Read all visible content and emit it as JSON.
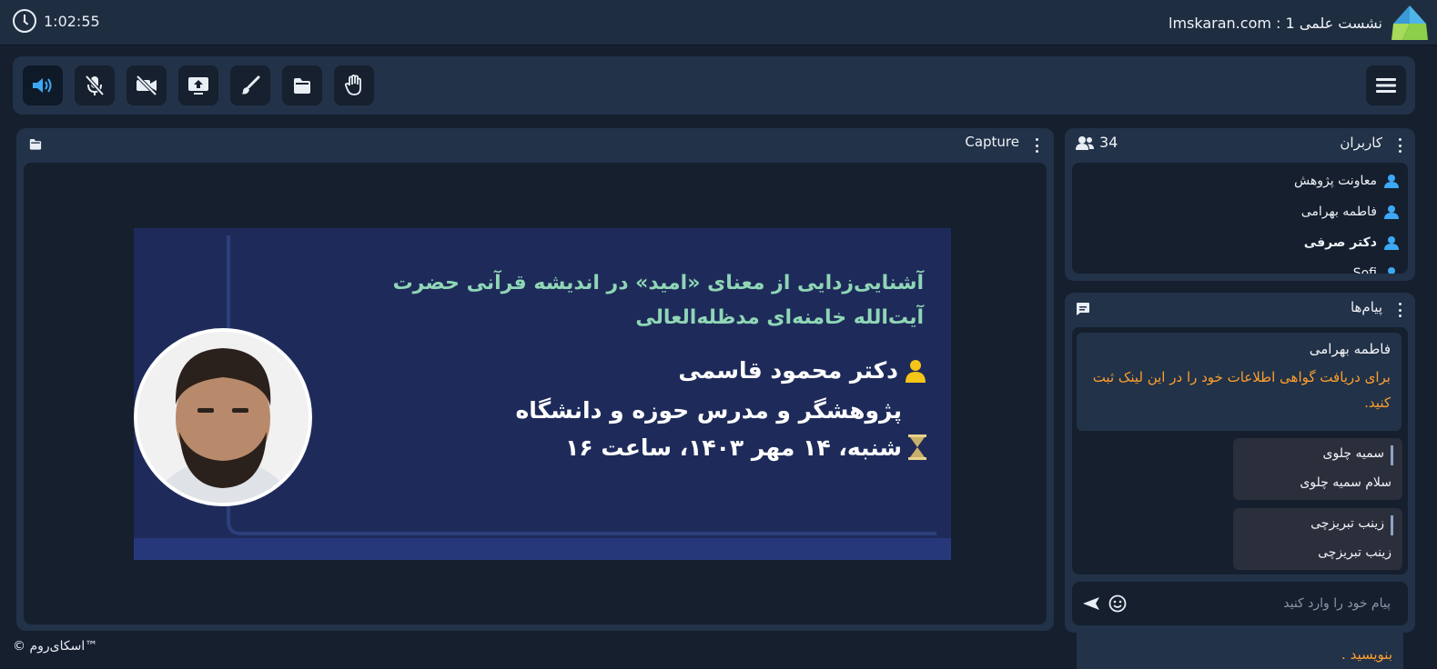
{
  "header": {
    "timer": "1:02:55",
    "title": "lmskaran.com : نشست علمی 1"
  },
  "toolbar": {
    "buttons": [
      {
        "name": "speaker",
        "icon": "speaker-icon",
        "active": true
      },
      {
        "name": "microphone",
        "icon": "mic-off-icon"
      },
      {
        "name": "camera",
        "icon": "video-off-icon"
      },
      {
        "name": "share-screen",
        "icon": "screen-share-icon"
      },
      {
        "name": "whiteboard",
        "icon": "brush-icon"
      },
      {
        "name": "files",
        "icon": "folder-icon"
      },
      {
        "name": "raise-hand",
        "icon": "hand-icon"
      }
    ],
    "menu_icon": "hamburger-icon"
  },
  "capture": {
    "title": "Capture",
    "slide": {
      "title_line1": "آشنایی‌زدایی از معنای «امید» در اندیشه قرآنی حضرت",
      "title_line2": "آیت‌الله خامنه‌ای مدظله‌العالی",
      "speaker": "دکتر محمود قاسمی",
      "role": "پژوهشگر و مدرس حوزه و دانشگاه",
      "date": "شنبه، ۱۴ مهر ۱۴۰۳، ساعت ۱۶"
    }
  },
  "users": {
    "title": "کاربران",
    "count": "34",
    "list": [
      {
        "name": "معاونت پژوهش",
        "bold": false
      },
      {
        "name": "فاطمه بهرامی",
        "bold": false
      },
      {
        "name": "دکتر صرفی",
        "bold": true
      },
      {
        "name": "Sofi",
        "bold": false
      }
    ]
  },
  "messages": {
    "title": "پیام‌ها",
    "pinned": {
      "sender": "فاطمه بهرامی",
      "text": "برای دریافت گواهی اطلاعات خود را در این لینک ثبت کنید."
    },
    "items": [
      {
        "sender": "سمیه چلوی",
        "text": "سلام سمیه چلوی"
      },
      {
        "sender": "زینب تبریزچی",
        "text": "زینب تبریزچی"
      }
    ],
    "input_placeholder": "پیام خود را وارد کنید",
    "overflow_text": "بنویسید ."
  },
  "footer": {
    "copyright": "© اسکای‌روم™"
  },
  "colors": {
    "background": "#151f2e",
    "panel": "#223248",
    "accent_blue": "#3da8f5",
    "warning_orange": "#ff9f2e"
  }
}
